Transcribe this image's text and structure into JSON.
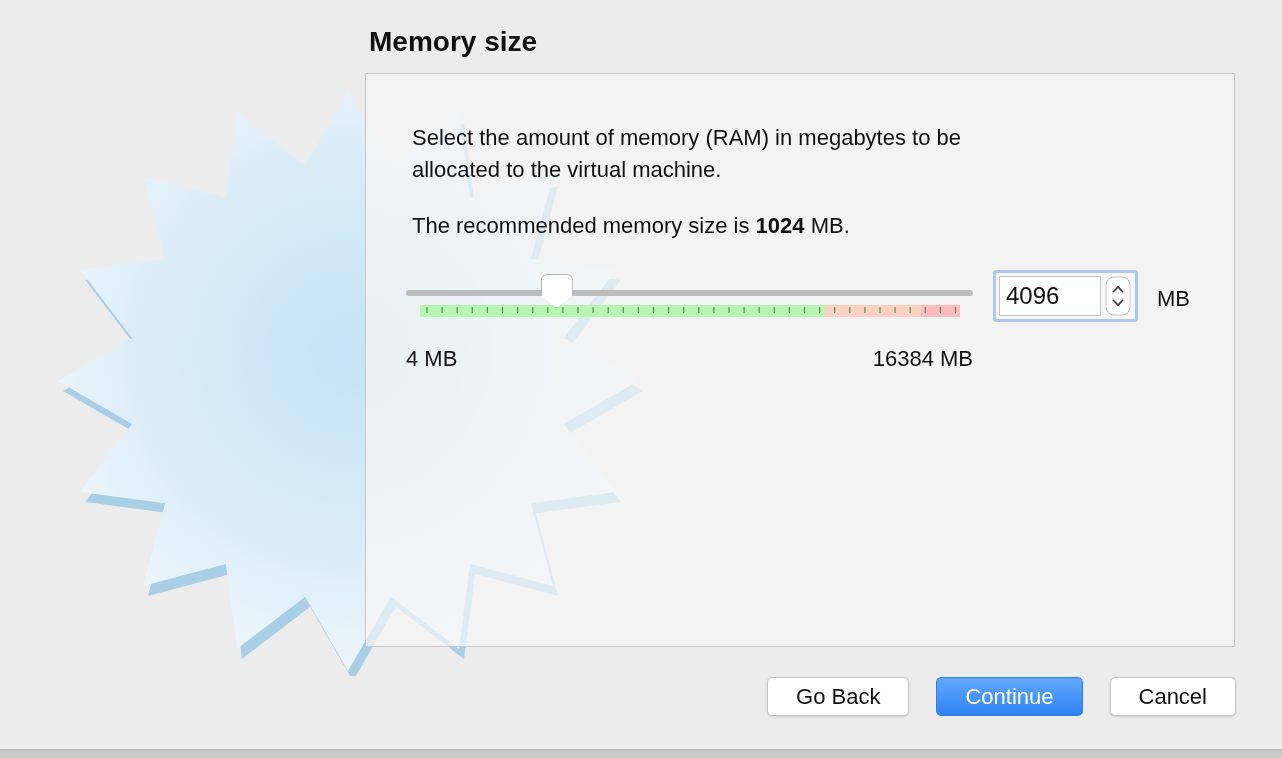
{
  "title": "Memory size",
  "description": "Select the amount of memory (RAM) in megabytes to be allocated to the virtual machine.",
  "recommendation": "The recommended memory size is **1024** MB.",
  "slider": {
    "level": 0.25,
    "min_label": "4 MB",
    "max_label": "16384 MB"
  },
  "spinbox": {
    "value": "4096",
    "unit": "MB"
  },
  "buttons": [
    {
      "label": "Go Back",
      "kind": "normal"
    },
    {
      "label": "Continue",
      "kind": "default"
    },
    {
      "label": "Cancel",
      "kind": "normal"
    }
  ]
}
